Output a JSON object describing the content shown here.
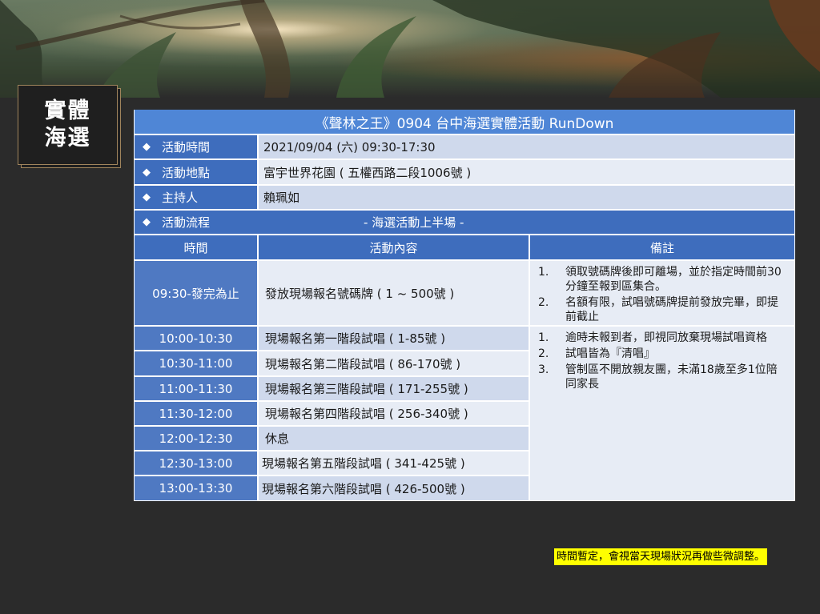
{
  "badge": {
    "line1": "實體",
    "line2": "海選"
  },
  "table": {
    "title": "《聲林之王》0904 台中海選實體活動 RunDown",
    "info": [
      {
        "label": "活動時間",
        "value": "2021/09/04 (六) 09:30-17:30"
      },
      {
        "label": "活動地點",
        "value": "富宇世界花園 ( 五權西路二段1006號 )"
      },
      {
        "label": "主持人",
        "value": "賴珮如"
      }
    ],
    "flow": {
      "label": "活動流程",
      "value": "- 海選活動上半場 -"
    },
    "headers": {
      "time": "時間",
      "content": "活動內容",
      "note": "備註"
    },
    "rows": [
      {
        "time": "09:30-發完為止",
        "content": "發放現場報名號碼牌 ( 1 ~ 500號 )"
      },
      {
        "time": "10:00-10:30",
        "content": "現場報名第一階段試唱 ( 1-85號 )"
      },
      {
        "time": "10:30-11:00",
        "content": "現場報名第二階段試唱 ( 86-170號 )"
      },
      {
        "time": "11:00-11:30",
        "content": "現場報名第三階段試唱 ( 171-255號 )"
      },
      {
        "time": "11:30-12:00",
        "content": "現場報名第四階段試唱 ( 256-340號 )"
      },
      {
        "time": "12:00-12:30",
        "content": "休息"
      },
      {
        "time": "12:30-13:00",
        "content": "現場報名第五階段試唱 ( 341-425號 )"
      },
      {
        "time": "13:00-13:30",
        "content": "現場報名第六階段試唱 ( 426-500號 )"
      }
    ],
    "notes_a": [
      {
        "num": "1.",
        "text": "領取號碼牌後即可離場，並於指定時間前30分鐘至報到區集合。"
      },
      {
        "num": "2.",
        "text": "名額有限，試唱號碼牌提前發放完畢，即提前截止"
      }
    ],
    "notes_b": [
      {
        "num": "1.",
        "text": "逾時未報到者，即視同放棄現場試唱資格"
      },
      {
        "num": "2.",
        "text": "試唱皆為『清唱』"
      },
      {
        "num": "3.",
        "text": "管制區不開放親友團，未滿18歲至多1位陪同家長"
      }
    ]
  },
  "disclaimer": "時間暫定，會視當天現場狀況再做些微調整。",
  "colors": {
    "header_dark": "#3e6dbd",
    "title_blue": "#4f86d6",
    "row_light": "#cfd9ec",
    "row_lighter": "#e7ecf5",
    "highlight": "#ffff00",
    "background": "#2b2b2b"
  },
  "icons": {
    "bullet": "diamond-icon"
  }
}
